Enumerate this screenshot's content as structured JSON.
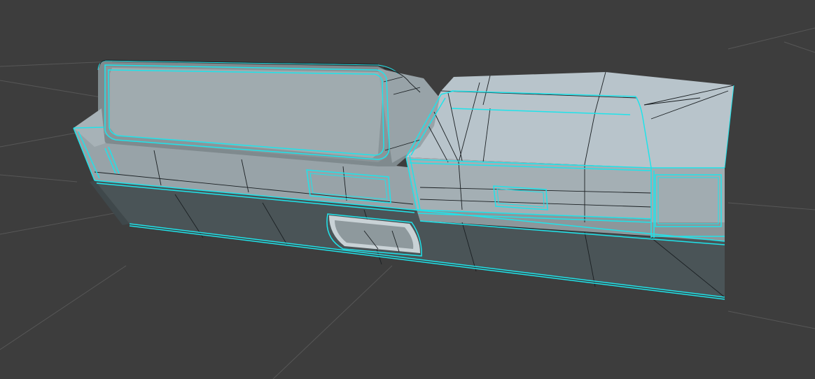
{
  "viewport": {
    "background_color": "#3d3d3d",
    "grid_color": "#575757",
    "seam_color": "#1fe3ea",
    "wire_color": "#1a1f22",
    "mesh_top_color": "#b7c3ca",
    "mesh_front_color": "#96a1a6",
    "mesh_lower_color": "#4a5457"
  }
}
